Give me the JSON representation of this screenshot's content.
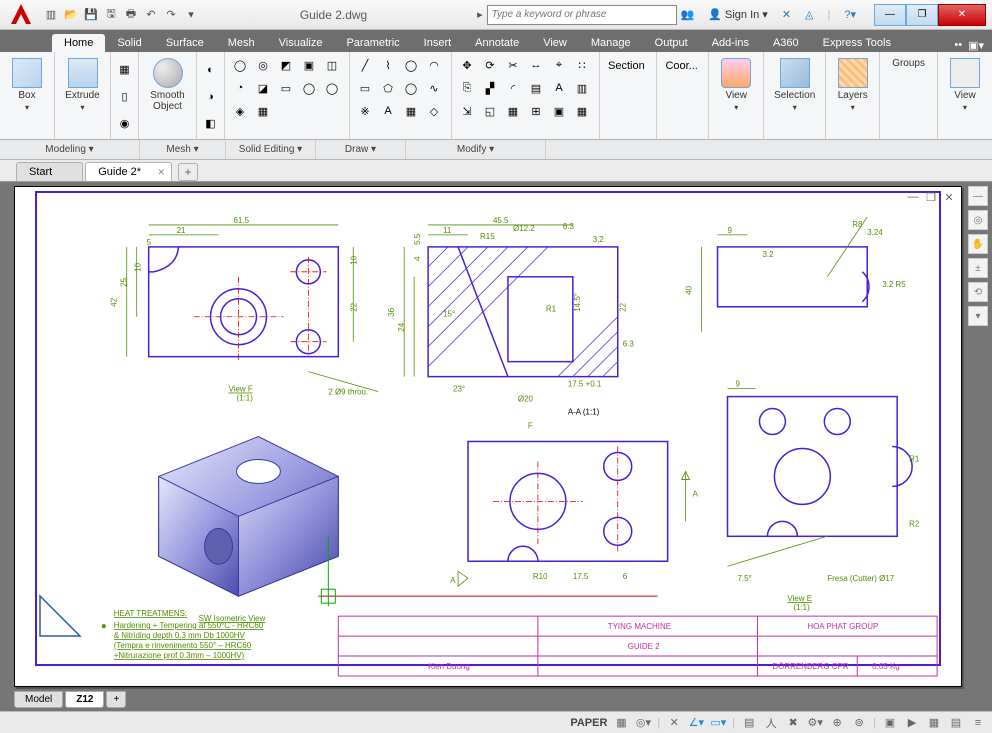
{
  "titlebar": {
    "filename": "Guide 2.dwg",
    "search_placeholder": "Type a keyword or phrase",
    "signin": "Sign In"
  },
  "menutabs": [
    "Home",
    "Solid",
    "Surface",
    "Mesh",
    "Visualize",
    "Parametric",
    "Insert",
    "Annotate",
    "View",
    "Manage",
    "Output",
    "Add-ins",
    "A360",
    "Express Tools"
  ],
  "ribbon": {
    "box": "Box",
    "extrude": "Extrude",
    "smooth": "Smooth Object",
    "section": "Section",
    "coor": "Coor...",
    "view": "View",
    "selection": "Selection",
    "layers": "Layers",
    "groups": "Groups",
    "view2": "View"
  },
  "subribbon": {
    "modeling": "Modeling ▾",
    "mesh": "Mesh ▾",
    "solidedit": "Solid Editing ▾",
    "draw": "Draw ▾",
    "modify": "Modify ▾"
  },
  "filetabs": {
    "start": "Start",
    "file1": "Guide 2*"
  },
  "modeltabs": {
    "model": "Model",
    "layout": "Z12"
  },
  "status": {
    "space": "PAPER"
  },
  "drawing": {
    "dims": {
      "a": "61.5",
      "b": "21",
      "c": "5",
      "d": "10",
      "e": "42",
      "f": "25",
      "g": "22",
      "h": "10",
      "i": "2 Ø9 throu.",
      "j": "45.5",
      "k": "11",
      "l": "R15",
      "m": "Ø12.2",
      "n": "6.3",
      "o": "3.2",
      "p": "5.5",
      "q": "4",
      "r": "24",
      "s": "36",
      "t": "15°",
      "u": "23°",
      "v": "Ø20",
      "w": "17.5 +0.1",
      "x": "R1",
      "y": "14.5°",
      "z": "6.3",
      "aa": "22",
      "sec": "A-A (1:1)",
      "arrf": "F",
      "arra": "A",
      "ta": "A",
      "ve": "View E",
      "ve2": "(1:1)",
      "vf": "View F",
      "vf2": "(1:1)",
      "iso": "SW Isometric View",
      "b9": "9",
      "b32": "3.2",
      "b40": "40",
      "r8": "R8",
      "r324": "3.24",
      "r325": "3.2 R5",
      "r10": "R10",
      "r175": "17.5",
      "r6": "6",
      "b92": "9",
      "r1b": "R1",
      "r2": "R2",
      "fresa": "Fresa (Cutter) Ø17",
      "ang75": "7.5°"
    },
    "heat": {
      "title": "HEAT TREATMENS:",
      "l1": "Hardening + Tempering at 550°C - HRC60",
      "l2": "& Nitriding depth 0.3 mm Db 1000HV",
      "l3": "(Tempra e rinvenimento 550° – HRC60",
      "l4": "+Nitrurazione prof 0.3mm – 1000HV)"
    },
    "titleblock": {
      "project": "TYING MACHINE",
      "company": "HOA PHAT GROUP",
      "part": "GUIDE 2",
      "author": "Kien Duong",
      "material": "DÖRRENBERG CPR",
      "weight": "0.65 Kg"
    }
  }
}
